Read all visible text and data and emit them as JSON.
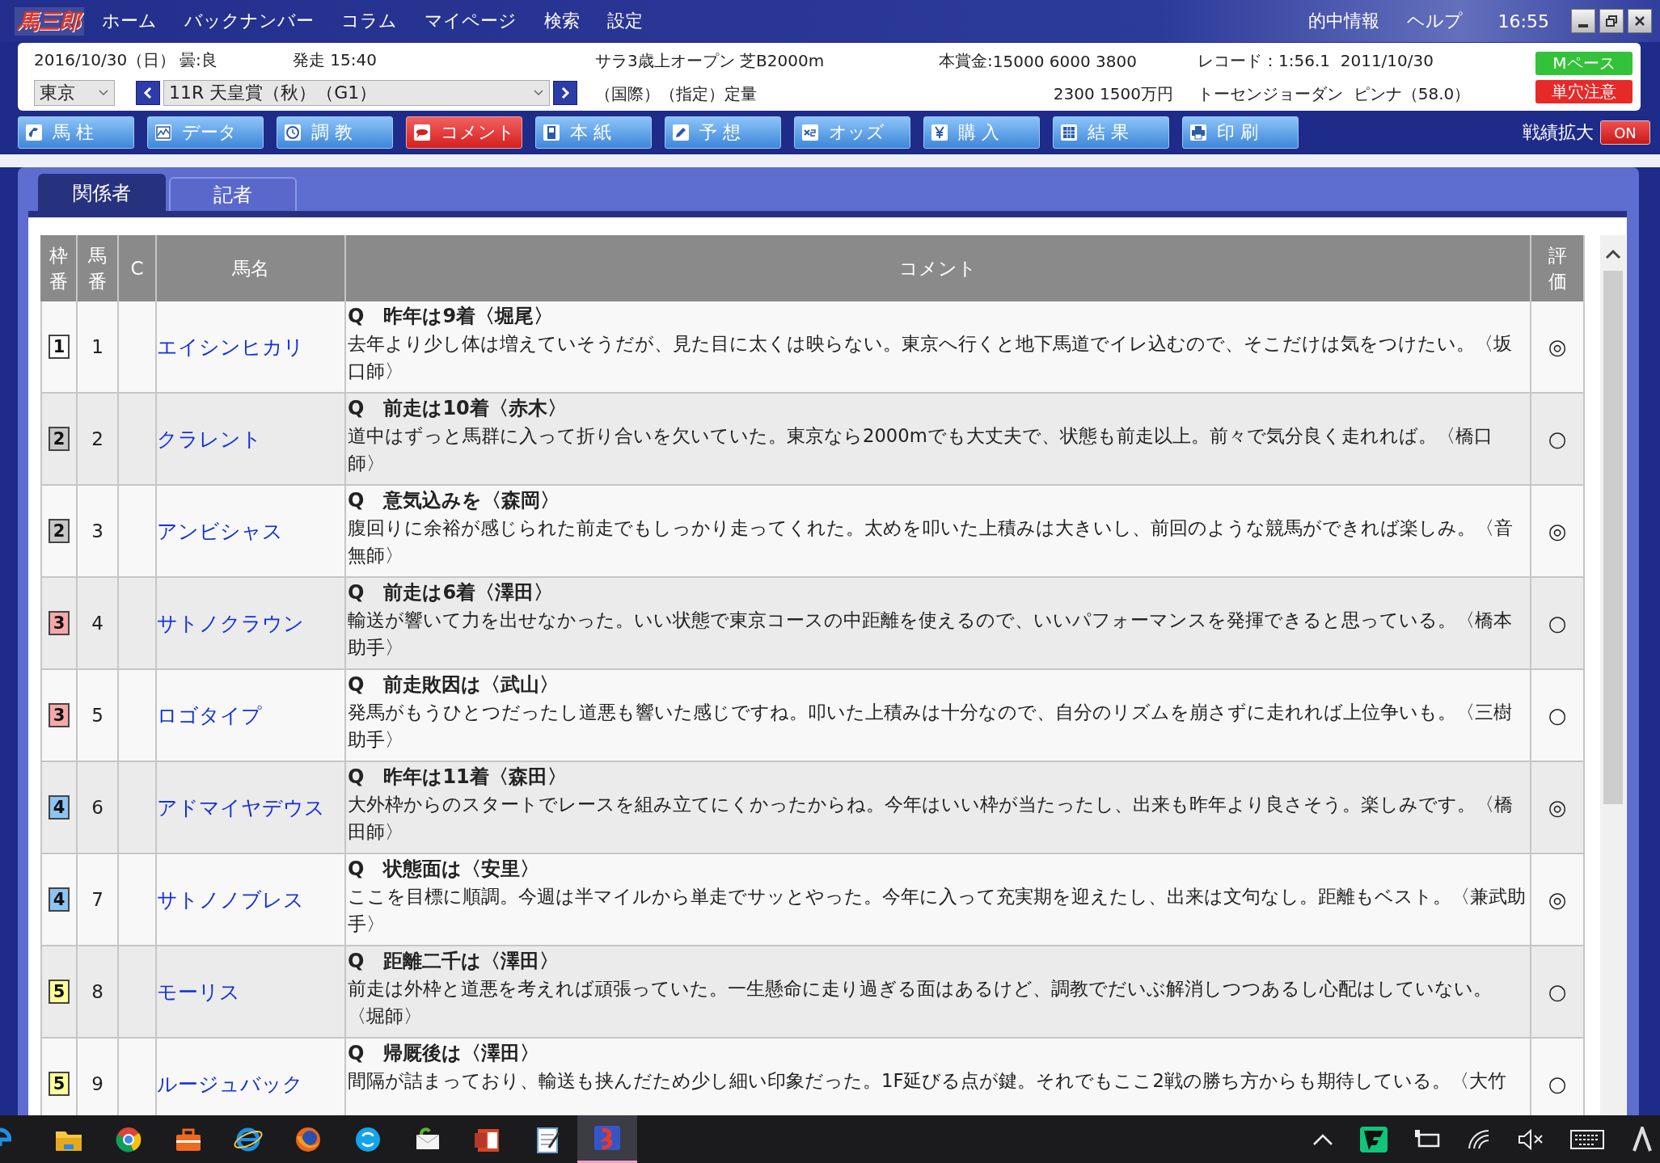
{
  "app": {
    "logo": "馬三郎"
  },
  "menu": [
    "ホーム",
    "バックナンバー",
    "コラム",
    "マイページ",
    "検索",
    "設定"
  ],
  "header_links": [
    "的中情報",
    "ヘルプ"
  ],
  "clock": "16:55",
  "race_info": {
    "date": "2016/10/30（日）",
    "weather": "曇:良",
    "start": "発走 15:40",
    "class": "サラ3歳上オープン 芝B2000m",
    "conditions": "（国際）（指定）定量",
    "prize_label": "本賞金:",
    "prize_line_1": "15000 6000 3800",
    "prize_line_2": "2300 1500万円",
    "record_line_1": "レコード：1:56.1  2011/10/30",
    "record_line_2": "トーセンジョーダン  ピンナ（58.0）",
    "venue": "東京",
    "race": "11R 天皇賞（秋）（G1）",
    "badges": [
      {
        "label": "Mペース",
        "color": "#33c23a"
      },
      {
        "label": "単穴注意",
        "color": "#e62a2a"
      }
    ]
  },
  "toolbar": [
    {
      "label": "馬 柱",
      "kind": "horse",
      "selected": false
    },
    {
      "label": "データ",
      "kind": "chart",
      "selected": false
    },
    {
      "label": "調 教",
      "kind": "clock",
      "selected": false
    },
    {
      "label": "コメント",
      "kind": "speech",
      "selected": true
    },
    {
      "label": "本 紙",
      "kind": "page",
      "selected": false
    },
    {
      "label": "予 想",
      "kind": "pencil",
      "selected": false
    },
    {
      "label": "オッズ",
      "kind": "double",
      "selected": false
    },
    {
      "label": "購 入",
      "kind": "coin",
      "selected": false
    },
    {
      "label": "結 果",
      "kind": "grid",
      "selected": false
    },
    {
      "label": "印 刷",
      "kind": "printer",
      "selected": false
    }
  ],
  "expand_toggle": {
    "label": "戦績拡大",
    "state": "ON",
    "on": true
  },
  "tabs": [
    {
      "label": "関係者",
      "selected": true
    },
    {
      "label": "記者",
      "selected": false
    }
  ],
  "table": {
    "columns": [
      "枠番",
      "馬番",
      "C",
      "馬名",
      "コメント",
      "評価"
    ],
    "rows": [
      {
        "frame": "1",
        "color": "#ffffff",
        "number": "1",
        "name": "エイシンヒカリ",
        "question": "Q　昨年は9着〈堀尾〉",
        "comment": "去年より少し体は増えていそうだが、見た目に太くは映らない。東京へ行くと地下馬道でイレ込むので、そこだけは気をつけたい。〈坂口師〉",
        "rating": "◎"
      },
      {
        "frame": "2",
        "color": "#c8c8c8",
        "number": "2",
        "name": "クラレント",
        "question": "Q　前走は10着〈赤木〉",
        "comment": "道中はずっと馬群に入って折り合いを欠いていた。東京なら2000mでも大丈夫で、状態も前走以上。前々で気分良く走れれば。〈橋口師〉",
        "rating": "○"
      },
      {
        "frame": "2",
        "color": "#c8c8c8",
        "number": "3",
        "name": "アンビシャス",
        "question": "Q　意気込みを〈森岡〉",
        "comment": "腹回りに余裕が感じられた前走でもしっかり走ってくれた。太めを叩いた上積みは大きいし、前回のような競馬ができれば楽しみ。〈音無師〉",
        "rating": "◎"
      },
      {
        "frame": "3",
        "color": "#f6a8a8",
        "number": "4",
        "name": "サトノクラウン",
        "question": "Q　前走は6着〈澤田〉",
        "comment": "輸送が響いて力を出せなかった。いい状態で東京コースの中距離を使えるので、いいパフォーマンスを発揮できると思っている。〈橋本助手〉",
        "rating": "○"
      },
      {
        "frame": "3",
        "color": "#f6a8a8",
        "number": "5",
        "name": "ロゴタイプ",
        "question": "Q　前走敗因は〈武山〉",
        "comment": "発馬がもうひとつだったし道悪も響いた感じですね。叩いた上積みは十分なので、自分のリズムを崩さずに走れれば上位争いも。〈三樹助手〉",
        "rating": "○"
      },
      {
        "frame": "4",
        "color": "#8cc4f2",
        "number": "6",
        "name": "アドマイヤデウス",
        "question": "Q　昨年は11着〈森田〉",
        "comment": "大外枠からのスタートでレースを組み立てにくかったからね。今年はいい枠が当たったし、出来も昨年より良さそう。楽しみです。〈橋田師〉",
        "rating": "◎"
      },
      {
        "frame": "4",
        "color": "#8cc4f2",
        "number": "7",
        "name": "サトノノブレス",
        "question": "Q　状態面は〈安里〉",
        "comment": "ここを目標に順調。今週は半マイルから単走でサッとやった。今年に入って充実期を迎えたし、出来は文句なし。距離もベスト。〈兼武助手〉",
        "rating": "◎"
      },
      {
        "frame": "5",
        "color": "#ffff99",
        "number": "8",
        "name": "モーリス",
        "question": "Q　距離二千は〈澤田〉",
        "comment": "前走は外枠と道悪を考えれば頑張っていた。一生懸命に走り過ぎる面はあるけど、調教でだいぶ解消しつつあるし心配はしていない。〈堀師〉",
        "rating": "○"
      },
      {
        "frame": "5",
        "color": "#ffff99",
        "number": "9",
        "name": "ルージュバック",
        "question": "Q　帰厩後は〈澤田〉",
        "comment": "間隔が詰まっており、輸送も挟んだため少し細い印象だった。1F延びる点が鍵。それでもここ2戦の勝ち方からも期待している。〈大竹",
        "rating": "○"
      }
    ]
  }
}
